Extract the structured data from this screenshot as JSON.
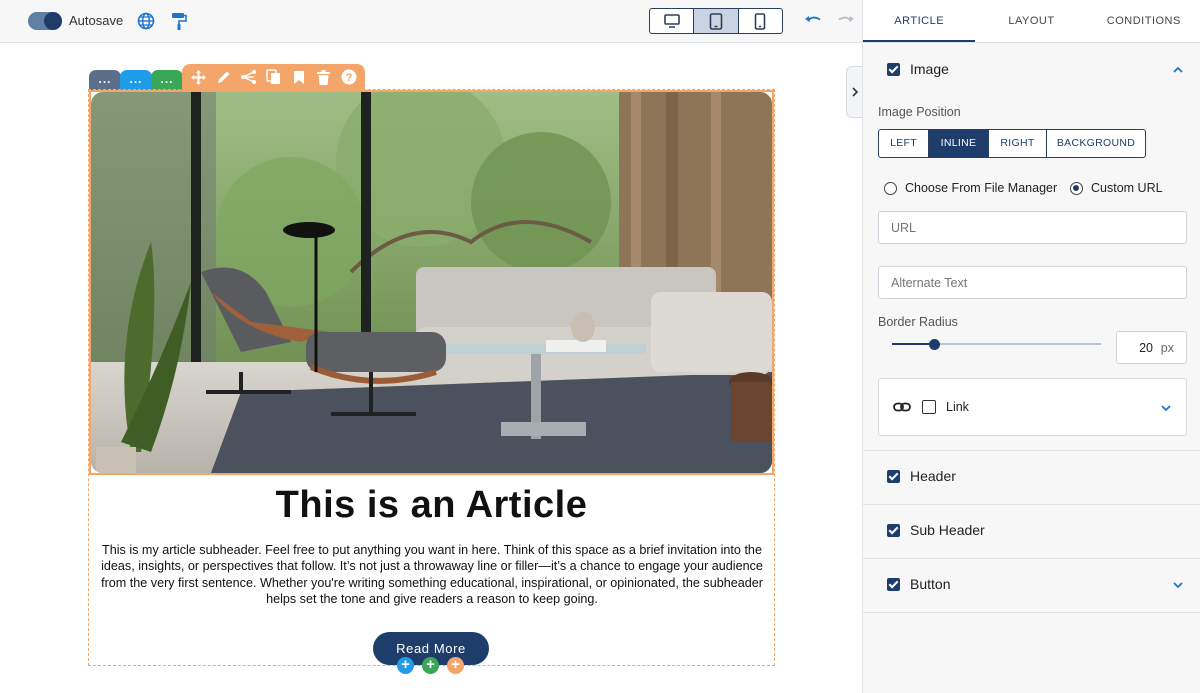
{
  "toolbar": {
    "autosave_label": "Autosave",
    "autosave_on": true,
    "icons": [
      "globe-icon",
      "paint-roller-icon",
      "undo-icon",
      "redo-icon"
    ],
    "devices": [
      {
        "name": "desktop",
        "active": false
      },
      {
        "name": "tablet",
        "active": true
      },
      {
        "name": "mobile",
        "active": false
      }
    ]
  },
  "canvas": {
    "block_chips": [
      {
        "label": "...",
        "color": "#5b6f8a"
      },
      {
        "label": "...",
        "color": "#1e9be9"
      },
      {
        "label": "...",
        "color": "#3aa657"
      }
    ],
    "element_actions": [
      "move-icon",
      "edit-icon",
      "share-icon",
      "duplicate-icon",
      "bookmark-icon",
      "trash-icon",
      "help-icon"
    ],
    "accent_color": "#f4a66a",
    "article": {
      "title": "This is an Article",
      "subheader": "This is my article subheader. Feel free to put anything you want in here. Think of this space as a brief invitation into the ideas, insights, or perspectives that follow. It’s not just a throwaway line or filler—it’s a chance to engage your audience from the very first sentence. Whether you're writing something educational, inspirational, or opinionated, the subheader helps set the tone and give readers a reason to keep going.",
      "button_label": "Read More",
      "button_color": "#1f3d6b"
    },
    "add_buttons": [
      {
        "label": "+",
        "color": "#1e9be9"
      },
      {
        "label": "+",
        "color": "#3aa657"
      },
      {
        "label": "+",
        "color": "#f4a66a"
      }
    ]
  },
  "panel": {
    "tabs": [
      {
        "label": "ARTICLE",
        "active": true
      },
      {
        "label": "LAYOUT",
        "active": false
      },
      {
        "label": "CONDITIONS",
        "active": false
      }
    ],
    "image_section": {
      "label": "Image",
      "checked": true,
      "expanded": true,
      "position_label": "Image Position",
      "positions": [
        {
          "label": "LEFT",
          "active": false
        },
        {
          "label": "INLINE",
          "active": true
        },
        {
          "label": "RIGHT",
          "active": false
        },
        {
          "label": "BACKGROUND",
          "active": false
        }
      ],
      "source_options": [
        {
          "label": "Choose From File Manager",
          "selected": false
        },
        {
          "label": "Custom URL",
          "selected": true
        }
      ],
      "url_placeholder": "URL",
      "alt_placeholder": "Alternate Text",
      "border_radius_label": "Border Radius",
      "border_radius_value": "20",
      "border_radius_unit": "px",
      "border_radius_slider_fraction": 0.2,
      "link_label": "Link",
      "link_checked": false
    },
    "sections": [
      {
        "label": "Header",
        "checked": true
      },
      {
        "label": "Sub Header",
        "checked": true
      },
      {
        "label": "Button",
        "checked": true
      }
    ]
  }
}
